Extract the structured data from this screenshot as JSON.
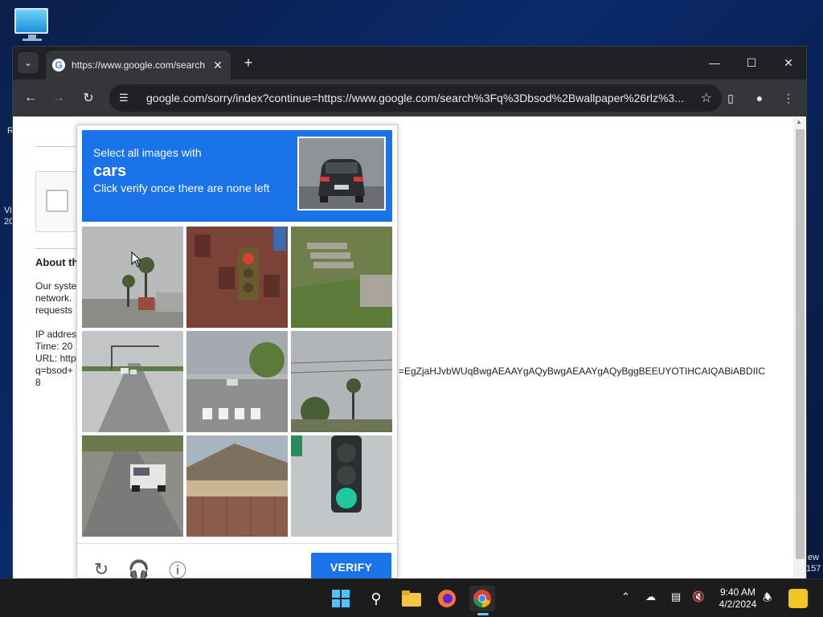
{
  "desktop": {
    "icon": "monitor-icon",
    "frag_left_1": "R",
    "frag_left_2": "Vi",
    "frag_left_3": "20",
    "frag_right_1": "ew",
    "frag_right_2": "157"
  },
  "browser": {
    "tab": {
      "title": "https://www.google.com/search",
      "favicon": "G",
      "close": "✕"
    },
    "new_tab": "+",
    "window_controls": {
      "minimize": "—",
      "maximize": "☐",
      "close": "✕"
    },
    "address": "google.com/sorry/index?continue=https://www.google.com/search%3Fq%3Dbsod%2Bwallpaper%26rlz%3..."
  },
  "page": {
    "about_title": "About th",
    "text_lines": [
      "Our syste",
      "network.",
      "requests"
    ],
    "ip_lines": [
      "IP addres",
      "Time: 20",
      "URL: http",
      "q=bsod+",
      "8"
    ],
    "url_tail": "=EgZjaHJvbWUqBwgAEAAYgAQyBwgAEAAYgAQyBggBEEUYOTIHCAIQABiABDIIC"
  },
  "captcha": {
    "instruction_line1": "Select all images with",
    "target": "cars",
    "instruction_line2": "Click verify once there are none left",
    "tiles": [
      "palm-trees-tile",
      "traffic-light-brick-tile",
      "garden-stairs-tile",
      "road-cars-tile",
      "crosswalk-road-tile",
      "palm-trees-sky-tile",
      "truck-road-tile",
      "house-fence-tile",
      "green-traffic-light-tile"
    ],
    "verify_label": "VERIFY",
    "reload_icon": "reload-icon",
    "audio_icon": "headphones-icon",
    "info_icon": "info-icon"
  },
  "taskbar": {
    "time": "9:40 AM",
    "date": "4/2/2024"
  }
}
